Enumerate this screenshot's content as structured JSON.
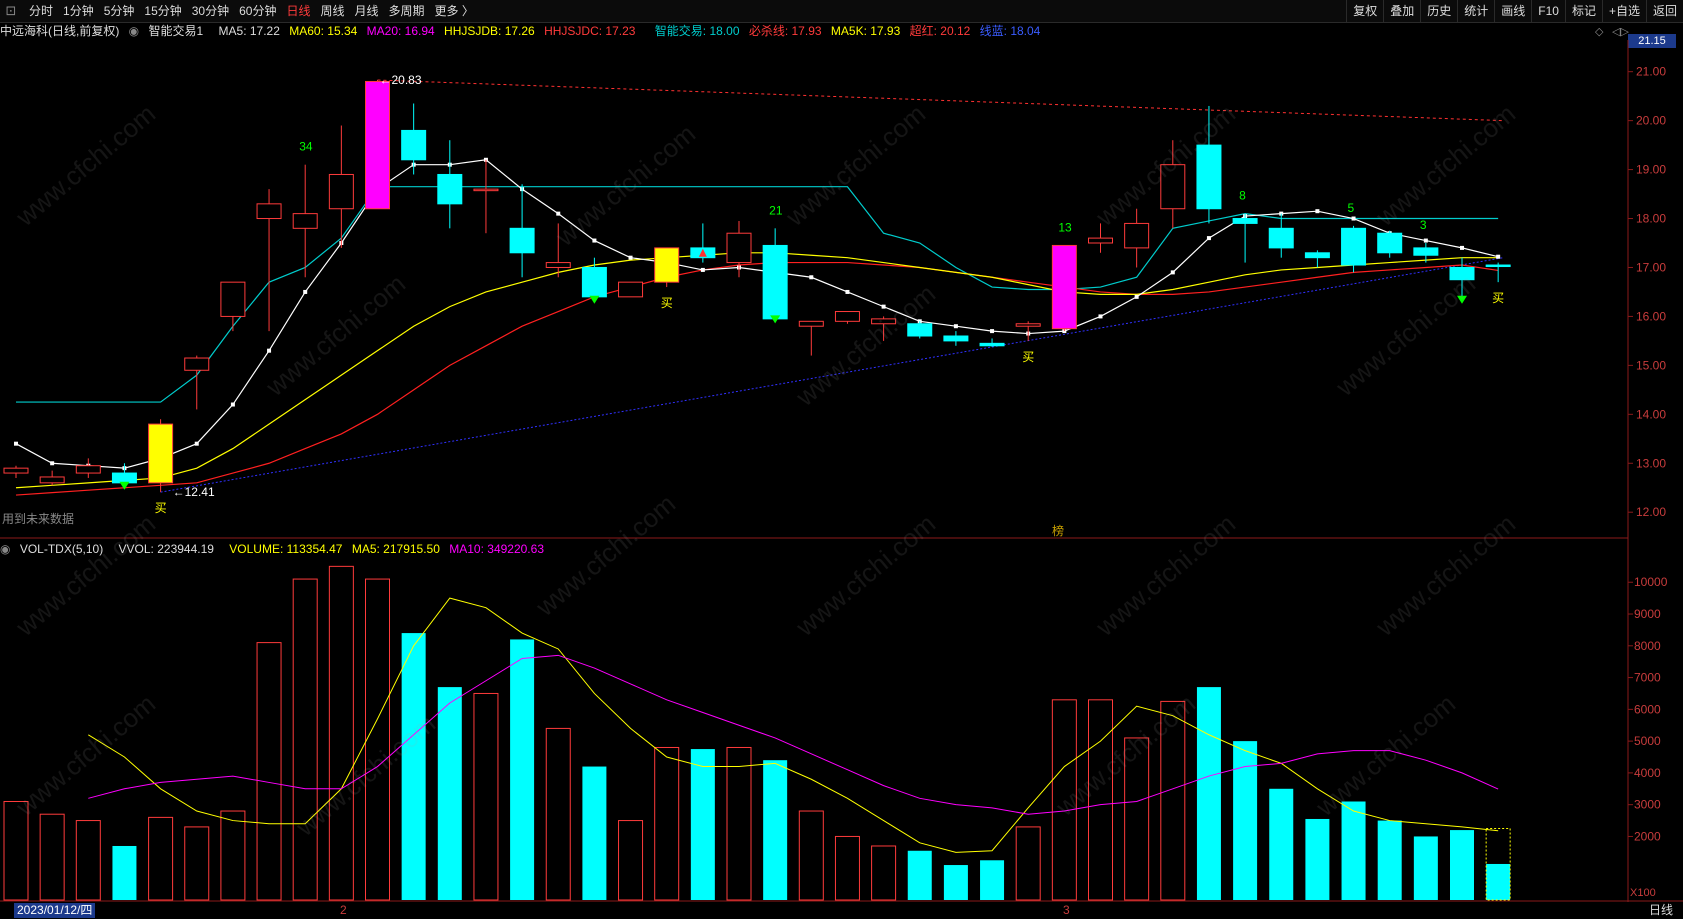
{
  "toolbar": {
    "periods": [
      {
        "label": "分时"
      },
      {
        "label": "1分钟"
      },
      {
        "label": "5分钟"
      },
      {
        "label": "15分钟"
      },
      {
        "label": "30分钟"
      },
      {
        "label": "60分钟"
      },
      {
        "label": "日线",
        "active": true
      },
      {
        "label": "周线"
      },
      {
        "label": "月线"
      },
      {
        "label": "多周期"
      },
      {
        "label": "更多 〉"
      }
    ],
    "right_buttons": [
      "复权",
      "叠加",
      "历史",
      "统计",
      "画线",
      "F10",
      "标记",
      "+自选",
      "返回"
    ]
  },
  "kline_info": {
    "name": "中远海科(日线,前复权)",
    "indicator": "智能交易1",
    "ma5": "MA5: 17.22",
    "ma60": "MA60: 15.34",
    "ma20": "MA20: 16.94",
    "hhjsjdb": "HHJSJDB: 17.26",
    "hhjsjdc": "HHJSJDC: 17.23",
    "zhineng": "智能交易: 18.00",
    "bisha": "必杀线: 17.93",
    "ma5k": "MA5K: 17.93",
    "chaohong": "超红: 20.12",
    "xianlan": "线蓝: 18.04"
  },
  "volume_info": {
    "name": "VOL-TDX(5,10)",
    "vvol": "VVOL: 223944.19",
    "volume": "VOLUME: 113354.47",
    "ma5": "MA5: 217915.50",
    "ma10": "MA10: 349220.63"
  },
  "colors": {
    "up": "#ff3b3b",
    "down": "#00ffff",
    "ma5": "#ffffff",
    "ma60": "#ffff00",
    "ma20": "#ff2020",
    "cyanline": "#00cccc",
    "magenta": "#ff00ff",
    "blue": "#2020ff",
    "vol_ma5": "#ffff00",
    "vol_ma10": "#ff00ff"
  },
  "price_tag": "21.15",
  "price_axis_labels": [
    "21.00",
    "20.00",
    "19.00",
    "18.00",
    "17.00",
    "16.00",
    "15.00",
    "14.00",
    "13.00",
    "12.00"
  ],
  "volume_axis_labels": [
    "10000",
    "9000",
    "8000",
    "7000",
    "6000",
    "5000",
    "4000",
    "3000",
    "2000"
  ],
  "volume_unit": "X100",
  "annotations": {
    "high_label": "←20.83",
    "low_label": "←12.41",
    "buy": "买",
    "count_labels": [
      "34",
      "21",
      "13",
      "8",
      "5",
      "3"
    ],
    "future_note": "用到未来数据",
    "mark": "榜"
  },
  "dates": {
    "current": "2023/01/12/四",
    "month_marks": [
      "2",
      "3"
    ]
  },
  "timeframe_label": "日线",
  "watermark": "www.cfchi.com",
  "chart_data": {
    "type": "candlestick",
    "ylim": [
      11.8,
      21.3
    ],
    "candles": [
      {
        "o": 12.8,
        "h": 12.95,
        "c": 12.9,
        "l": 12.7
      },
      {
        "o": 12.6,
        "h": 12.85,
        "c": 12.72,
        "l": 12.55
      },
      {
        "o": 12.8,
        "h": 13.1,
        "c": 12.95,
        "l": 12.7
      },
      {
        "o": 12.8,
        "h": 13.0,
        "c": 12.6,
        "l": 12.5
      },
      {
        "o": 12.6,
        "h": 13.9,
        "c": 13.8,
        "l": 12.41
      },
      {
        "o": 14.9,
        "h": 15.2,
        "c": 15.15,
        "l": 14.1
      },
      {
        "o": 16.0,
        "h": 16.7,
        "c": 16.7,
        "l": 15.7
      },
      {
        "o": 18.0,
        "h": 18.6,
        "c": 18.3,
        "l": 15.7
      },
      {
        "o": 17.8,
        "h": 19.1,
        "c": 18.1,
        "l": 16.8
      },
      {
        "o": 18.2,
        "h": 19.9,
        "c": 18.9,
        "l": 17.4
      },
      {
        "o": 18.2,
        "h": 20.83,
        "c": 20.8,
        "l": 18.2
      },
      {
        "o": 19.8,
        "h": 20.35,
        "c": 19.2,
        "l": 18.9
      },
      {
        "o": 18.9,
        "h": 19.6,
        "c": 18.3,
        "l": 17.8
      },
      {
        "o": 18.6,
        "h": 19.2,
        "c": 18.6,
        "l": 17.7
      },
      {
        "o": 17.8,
        "h": 18.7,
        "c": 17.3,
        "l": 16.8
      },
      {
        "o": 17.0,
        "h": 17.9,
        "c": 17.1,
        "l": 16.8
      },
      {
        "o": 17.0,
        "h": 17.2,
        "c": 16.4,
        "l": 16.3
      },
      {
        "o": 16.4,
        "h": 16.7,
        "c": 16.7,
        "l": 16.4
      },
      {
        "o": 16.7,
        "h": 17.4,
        "c": 17.4,
        "l": 16.6
      },
      {
        "o": 17.4,
        "h": 17.9,
        "c": 17.2,
        "l": 17.1
      },
      {
        "o": 17.1,
        "h": 17.95,
        "c": 17.7,
        "l": 16.8
      },
      {
        "o": 17.45,
        "h": 17.8,
        "c": 15.95,
        "l": 15.9
      },
      {
        "o": 15.8,
        "h": 15.9,
        "c": 15.9,
        "l": 15.2
      },
      {
        "o": 15.9,
        "h": 16.1,
        "c": 16.1,
        "l": 15.85
      },
      {
        "o": 15.85,
        "h": 16.0,
        "c": 15.95,
        "l": 15.5
      },
      {
        "o": 15.85,
        "h": 15.9,
        "c": 15.6,
        "l": 15.55
      },
      {
        "o": 15.6,
        "h": 15.7,
        "c": 15.5,
        "l": 15.4
      },
      {
        "o": 15.45,
        "h": 15.55,
        "c": 15.4,
        "l": 15.38
      },
      {
        "o": 15.8,
        "h": 15.9,
        "c": 15.85,
        "l": 15.5
      },
      {
        "o": 15.75,
        "h": 17.45,
        "c": 17.45,
        "l": 15.7
      },
      {
        "o": 17.5,
        "h": 17.9,
        "c": 17.6,
        "l": 17.3
      },
      {
        "o": 17.4,
        "h": 18.2,
        "c": 17.9,
        "l": 17.0
      },
      {
        "o": 18.2,
        "h": 19.6,
        "c": 19.1,
        "l": 17.8
      },
      {
        "o": 19.5,
        "h": 20.3,
        "c": 18.2,
        "l": 17.9
      },
      {
        "o": 18.0,
        "h": 18.1,
        "c": 17.9,
        "l": 17.1
      },
      {
        "o": 17.8,
        "h": 18.1,
        "c": 17.4,
        "l": 17.2
      },
      {
        "o": 17.3,
        "h": 17.35,
        "c": 17.2,
        "l": 17.0
      },
      {
        "o": 17.8,
        "h": 17.85,
        "c": 17.05,
        "l": 16.9
      },
      {
        "o": 17.7,
        "h": 17.75,
        "c": 17.3,
        "l": 17.2
      },
      {
        "o": 17.4,
        "h": 17.5,
        "c": 17.25,
        "l": 17.1
      },
      {
        "o": 17.0,
        "h": 17.2,
        "c": 16.75,
        "l": 16.3
      },
      {
        "o": 17.05,
        "h": 17.1,
        "c": 17.02,
        "l": 16.7
      }
    ],
    "ma5": [
      13.4,
      13.0,
      12.95,
      12.9,
      13.1,
      13.4,
      14.2,
      15.3,
      16.5,
      17.5,
      18.6,
      19.1,
      19.1,
      19.2,
      18.6,
      18.1,
      17.55,
      17.2,
      17.1,
      16.95,
      17.0,
      16.9,
      16.8,
      16.5,
      16.2,
      15.9,
      15.8,
      15.7,
      15.65,
      15.7,
      16.0,
      16.4,
      16.9,
      17.6,
      18.05,
      18.1,
      18.15,
      18.0,
      17.7,
      17.55,
      17.4,
      17.22
    ],
    "ma60": [
      12.5,
      12.55,
      12.6,
      12.65,
      12.7,
      12.9,
      13.3,
      13.8,
      14.3,
      14.8,
      15.3,
      15.8,
      16.2,
      16.5,
      16.7,
      16.9,
      17.05,
      17.15,
      17.2,
      17.25,
      17.3,
      17.3,
      17.25,
      17.2,
      17.1,
      17.0,
      16.9,
      16.8,
      16.65,
      16.5,
      16.45,
      16.45,
      16.55,
      16.7,
      16.85,
      16.95,
      17.0,
      17.05,
      17.1,
      17.15,
      17.2,
      17.2
    ],
    "ma20": [
      12.35,
      12.4,
      12.45,
      12.5,
      12.55,
      12.6,
      12.8,
      13.0,
      13.3,
      13.6,
      14.0,
      14.5,
      15.0,
      15.4,
      15.8,
      16.1,
      16.4,
      16.6,
      16.8,
      16.95,
      17.05,
      17.1,
      17.1,
      17.1,
      17.05,
      17.0,
      16.9,
      16.8,
      16.7,
      16.6,
      16.5,
      16.45,
      16.45,
      16.5,
      16.6,
      16.7,
      16.8,
      16.9,
      16.95,
      17.0,
      17.05,
      16.94
    ],
    "volume": [
      3100,
      2700,
      2500,
      1700,
      2600,
      2300,
      2800,
      8100,
      10100,
      10500,
      10100,
      8400,
      6700,
      6500,
      8200,
      5400,
      4200,
      2500,
      4800,
      4750,
      4800,
      4400,
      2800,
      2000,
      1700,
      1550,
      1100,
      1250,
      2300,
      6300,
      6300,
      5100,
      6250,
      6700,
      5000,
      3500,
      2550,
      3100,
      2500,
      2000,
      2200,
      1134
    ],
    "vol_ma5": [
      5200,
      4500,
      3500,
      2800,
      2500,
      2400,
      2400,
      3500,
      5700,
      8000,
      9500,
      9200,
      8400,
      7900,
      6500,
      5400,
      4500,
      4200,
      4200,
      4300,
      3800,
      3200,
      2500,
      1800,
      1500,
      1550,
      2900,
      4200,
      5000,
      6100,
      5800,
      5200,
      4700,
      4300,
      3500,
      2800,
      2500,
      2400,
      2300,
      2179
    ],
    "vol_ma10": [
      3200,
      3500,
      3700,
      3800,
      3900,
      3700,
      3500,
      3500,
      4200,
      5200,
      6200,
      6900,
      7600,
      7700,
      7300,
      6800,
      6300,
      5900,
      5500,
      5100,
      4600,
      4100,
      3600,
      3200,
      3000,
      2900,
      2700,
      2800,
      3000,
      3100,
      3500,
      3900,
      4200,
      4300,
      4600,
      4700,
      4700,
      4400,
      4000,
      3492
    ],
    "count_label_positions": [
      {
        "label": "34",
        "index": 8
      },
      {
        "label": "21",
        "index": 21
      },
      {
        "label": "13",
        "index": 29
      },
      {
        "label": "8",
        "index": 34
      },
      {
        "label": "5",
        "index": 37
      },
      {
        "label": "3",
        "index": 39
      }
    ],
    "buy_indices": [
      4,
      18,
      28,
      41
    ],
    "down_arrow_indices": [
      3,
      16,
      21,
      40
    ],
    "up_arrow_indices": [
      19
    ]
  }
}
